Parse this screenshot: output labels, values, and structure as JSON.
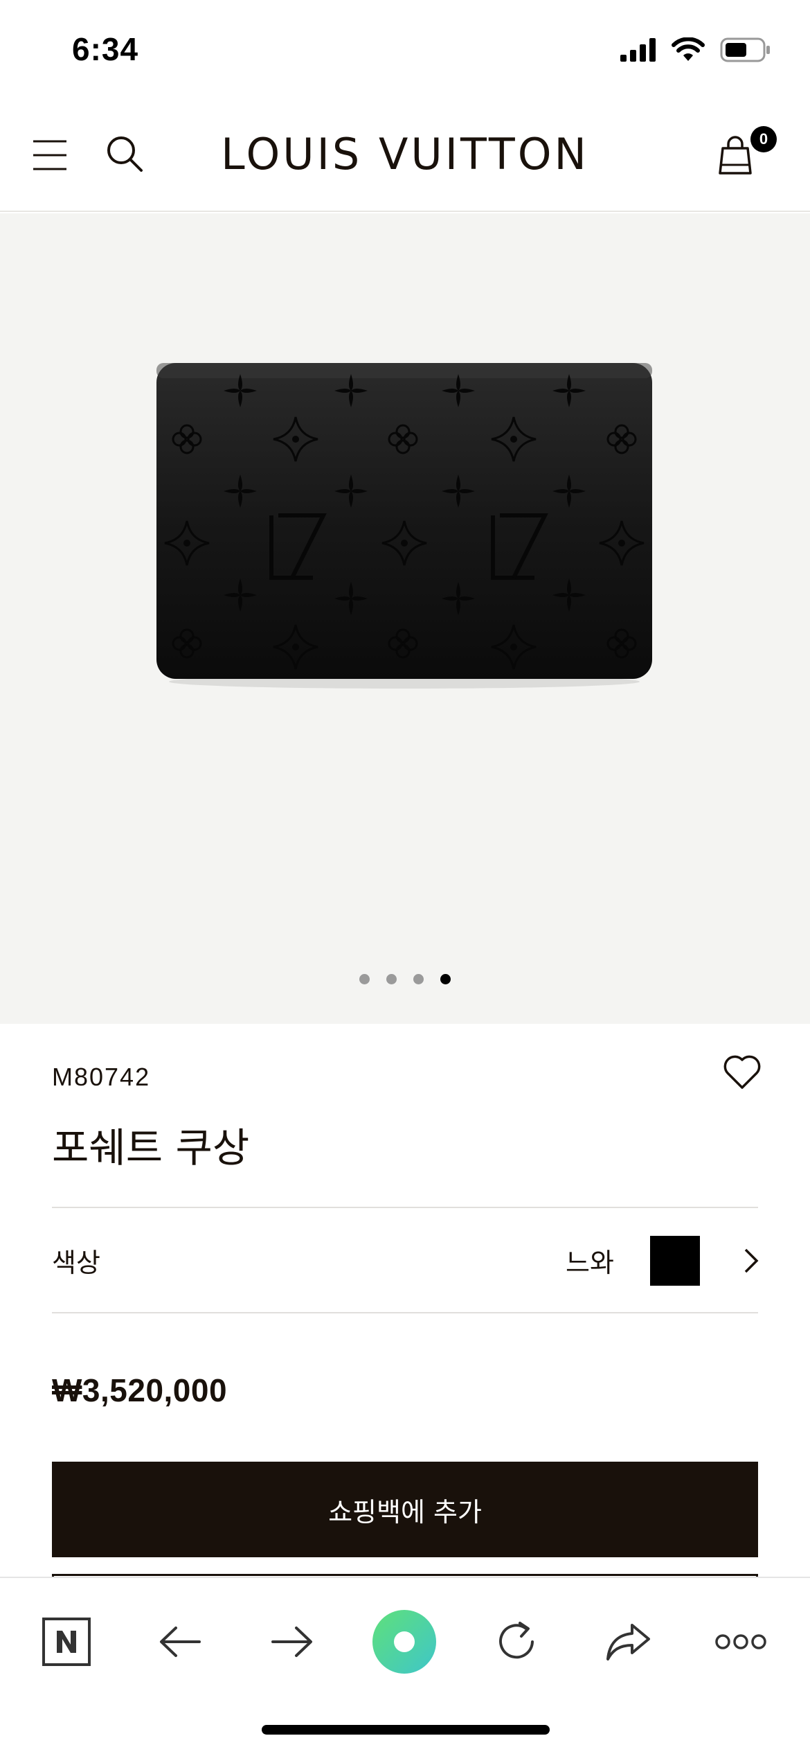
{
  "status_bar": {
    "time": "6:34"
  },
  "header": {
    "brand": "LOUIS VUITTON",
    "bag_count": "0"
  },
  "gallery": {
    "slides": 4,
    "active_slide": 4
  },
  "product": {
    "sku": "M80742",
    "name": "포쉐트 쿠상",
    "color_label": "색상",
    "color_value": "느와",
    "swatch_color": "#000000",
    "price": "₩3,520,000",
    "add_to_bag_label": "쇼핑백에 추가"
  },
  "browser_toolbar": {
    "icons": [
      "naver-n-icon",
      "back-arrow-icon",
      "forward-arrow-icon",
      "green-circle-home-icon",
      "reload-icon",
      "share-icon",
      "more-dots-icon"
    ],
    "accent": "#4dd9a0"
  }
}
